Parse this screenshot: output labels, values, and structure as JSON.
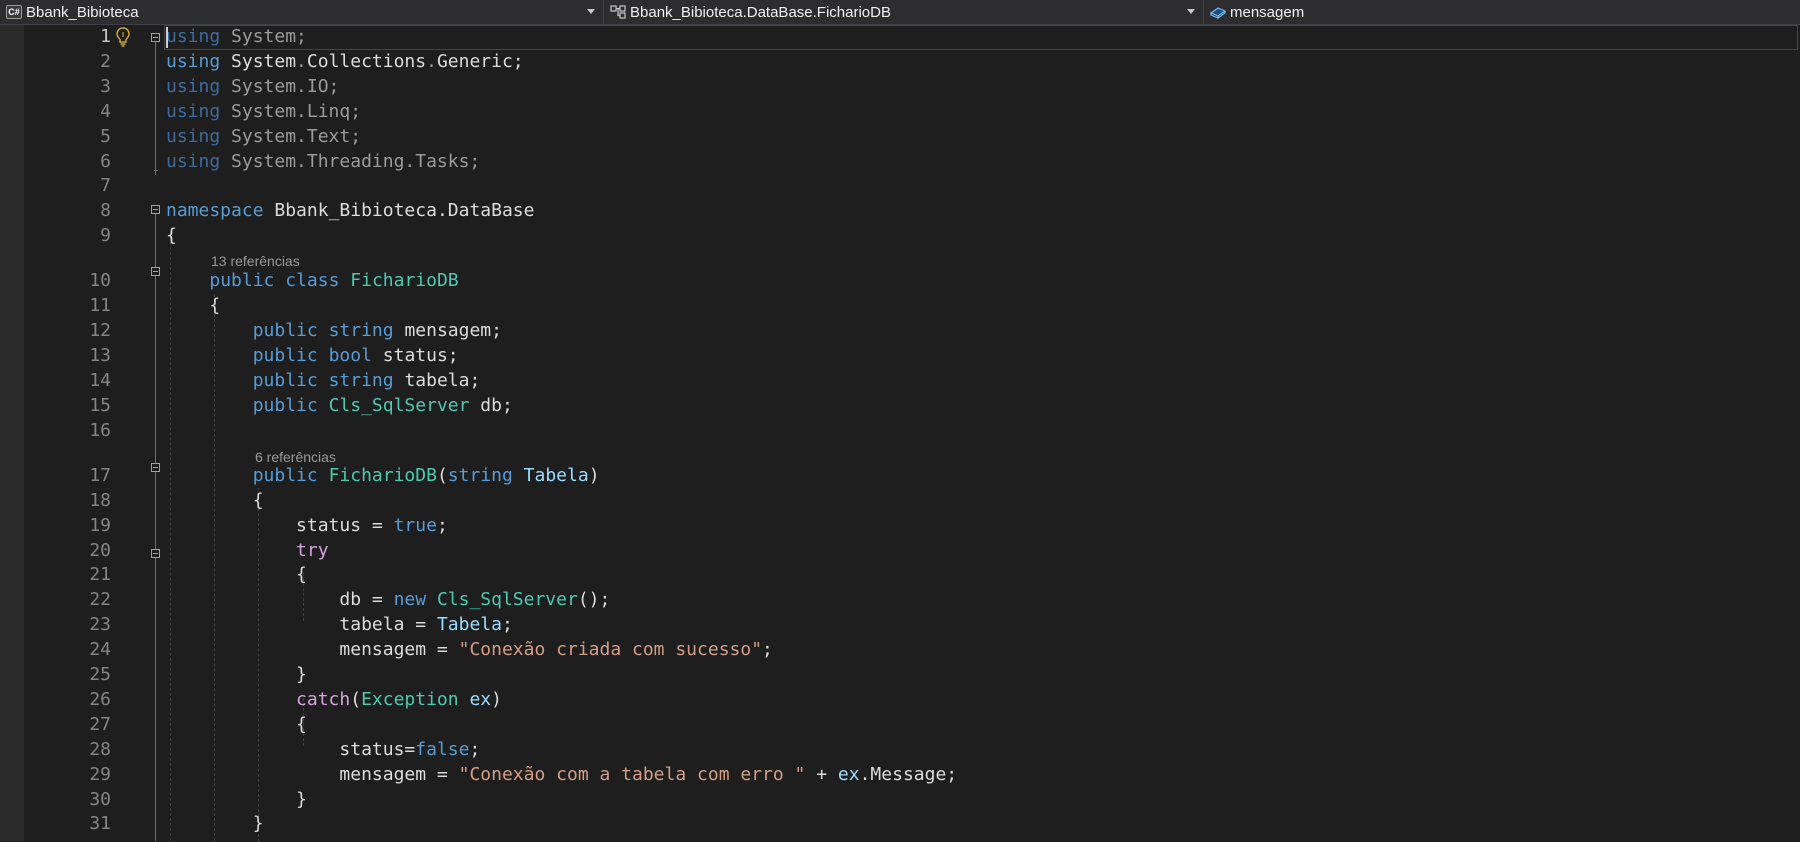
{
  "navbar": {
    "project": "Bbank_Bibioteca",
    "type": "Bbank_Bibioteca.DataBase.FicharioDB",
    "member": "mensagem"
  },
  "editor": {
    "current_line": 1,
    "lenses": [
      "13 referências",
      "6 referências"
    ],
    "lines": [
      {
        "n": "1",
        "tokens": [
          [
            "dimkw",
            "using"
          ],
          [
            "dim",
            " System;"
          ]
        ]
      },
      {
        "n": "2",
        "tokens": [
          [
            "kw",
            "using"
          ],
          [
            "pl",
            " System"
          ],
          [
            "dim",
            "."
          ],
          [
            "pl",
            "Collections"
          ],
          [
            "dim",
            "."
          ],
          [
            "pl",
            "Generic;"
          ]
        ]
      },
      {
        "n": "3",
        "tokens": [
          [
            "dimkw",
            "using"
          ],
          [
            "dim",
            " System.IO;"
          ]
        ]
      },
      {
        "n": "4",
        "tokens": [
          [
            "dimkw",
            "using"
          ],
          [
            "dim",
            " System.Linq;"
          ]
        ]
      },
      {
        "n": "5",
        "tokens": [
          [
            "dimkw",
            "using"
          ],
          [
            "dim",
            " System.Text;"
          ]
        ]
      },
      {
        "n": "6",
        "tokens": [
          [
            "dimkw",
            "using"
          ],
          [
            "dim",
            " System.Threading.Tasks;"
          ]
        ]
      },
      {
        "n": "7",
        "tokens": []
      },
      {
        "n": "8",
        "tokens": [
          [
            "kw",
            "namespace"
          ],
          [
            "pl",
            " Bbank_Bibioteca.DataBase"
          ]
        ]
      },
      {
        "n": "9",
        "tokens": [
          [
            "pl",
            "{"
          ]
        ]
      },
      {
        "n": "10",
        "tokens": [
          [
            "pl",
            "    "
          ],
          [
            "kw",
            "public"
          ],
          [
            "pl",
            " "
          ],
          [
            "kw",
            "class"
          ],
          [
            "pl",
            " "
          ],
          [
            "ty",
            "FicharioDB"
          ]
        ]
      },
      {
        "n": "11",
        "tokens": [
          [
            "pl",
            "    {"
          ]
        ]
      },
      {
        "n": "12",
        "tokens": [
          [
            "pl",
            "        "
          ],
          [
            "kw",
            "public"
          ],
          [
            "pl",
            " "
          ],
          [
            "kw",
            "string"
          ],
          [
            "pl",
            " mensagem;"
          ]
        ]
      },
      {
        "n": "13",
        "tokens": [
          [
            "pl",
            "        "
          ],
          [
            "kw",
            "public"
          ],
          [
            "pl",
            " "
          ],
          [
            "kw",
            "bool"
          ],
          [
            "pl",
            " status;"
          ]
        ]
      },
      {
        "n": "14",
        "tokens": [
          [
            "pl",
            "        "
          ],
          [
            "kw",
            "public"
          ],
          [
            "pl",
            " "
          ],
          [
            "kw",
            "string"
          ],
          [
            "pl",
            " tabela;"
          ]
        ]
      },
      {
        "n": "15",
        "tokens": [
          [
            "pl",
            "        "
          ],
          [
            "kw",
            "public"
          ],
          [
            "pl",
            " "
          ],
          [
            "ty",
            "Cls_SqlServer"
          ],
          [
            "pl",
            " db;"
          ]
        ]
      },
      {
        "n": "16",
        "tokens": []
      },
      {
        "n": "17",
        "tokens": [
          [
            "pl",
            "        "
          ],
          [
            "kw",
            "public"
          ],
          [
            "pl",
            " "
          ],
          [
            "ty",
            "FicharioDB"
          ],
          [
            "pl",
            "("
          ],
          [
            "kw",
            "string"
          ],
          [
            "pl",
            " "
          ],
          [
            "var",
            "Tabela"
          ],
          [
            "pl",
            ")"
          ]
        ]
      },
      {
        "n": "18",
        "tokens": [
          [
            "pl",
            "        {"
          ]
        ]
      },
      {
        "n": "19",
        "tokens": [
          [
            "pl",
            "            status = "
          ],
          [
            "kw",
            "true"
          ],
          [
            "pl",
            ";"
          ]
        ]
      },
      {
        "n": "20",
        "tokens": [
          [
            "pl",
            "            "
          ],
          [
            "ctl",
            "try"
          ]
        ]
      },
      {
        "n": "21",
        "tokens": [
          [
            "pl",
            "            {"
          ]
        ]
      },
      {
        "n": "22",
        "tokens": [
          [
            "pl",
            "                db = "
          ],
          [
            "kw",
            "new"
          ],
          [
            "pl",
            " "
          ],
          [
            "ty",
            "Cls_SqlServer"
          ],
          [
            "pl",
            "();"
          ]
        ]
      },
      {
        "n": "23",
        "tokens": [
          [
            "pl",
            "                tabela = "
          ],
          [
            "var",
            "Tabela"
          ],
          [
            "pl",
            ";"
          ]
        ]
      },
      {
        "n": "24",
        "tokens": [
          [
            "pl",
            "                mensagem = "
          ],
          [
            "str",
            "\"Conexão criada com sucesso\""
          ],
          [
            "pl",
            ";"
          ]
        ]
      },
      {
        "n": "25",
        "tokens": [
          [
            "pl",
            "            }"
          ]
        ]
      },
      {
        "n": "26",
        "tokens": [
          [
            "pl",
            "            "
          ],
          [
            "ctl",
            "catch"
          ],
          [
            "pl",
            "("
          ],
          [
            "ty",
            "Exception"
          ],
          [
            "pl",
            " "
          ],
          [
            "var",
            "ex"
          ],
          [
            "pl",
            ")"
          ]
        ]
      },
      {
        "n": "27",
        "tokens": [
          [
            "pl",
            "            {"
          ]
        ]
      },
      {
        "n": "28",
        "tokens": [
          [
            "pl",
            "                status="
          ],
          [
            "kw",
            "false"
          ],
          [
            "pl",
            ";"
          ]
        ]
      },
      {
        "n": "29",
        "tokens": [
          [
            "pl",
            "                mensagem = "
          ],
          [
            "str",
            "\"Conexão com a tabela com erro \""
          ],
          [
            "pl",
            " + "
          ],
          [
            "var",
            "ex"
          ],
          [
            "pl",
            ".Message;"
          ]
        ]
      },
      {
        "n": "30",
        "tokens": [
          [
            "pl",
            "            }"
          ]
        ]
      },
      {
        "n": "31",
        "tokens": [
          [
            "pl",
            "        }"
          ]
        ]
      }
    ]
  }
}
